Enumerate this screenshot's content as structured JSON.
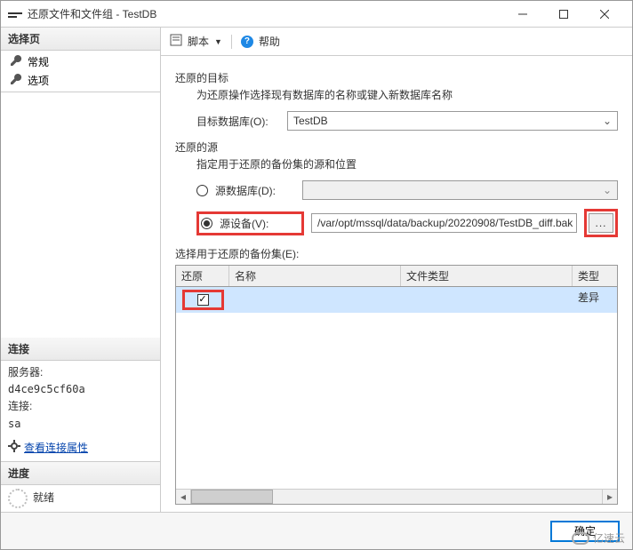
{
  "window": {
    "title": "还原文件和文件组 - TestDB"
  },
  "sidebar": {
    "select_page": "选择页",
    "items": [
      "常规",
      "选项"
    ],
    "connection_header": "连接",
    "server_label": "服务器:",
    "server_value": "d4ce9c5cf60a",
    "conn_label": "连接:",
    "conn_value": "sa",
    "view_props": "查看连接属性",
    "progress_header": "进度",
    "progress_status": "就绪"
  },
  "toolbar": {
    "script_label": "脚本",
    "help_label": "帮助"
  },
  "restore": {
    "target_title": "还原的目标",
    "target_sub": "为还原操作选择现有数据库的名称或键入新数据库名称",
    "target_db_label": "目标数据库(O):",
    "target_db_value": "TestDB",
    "source_title": "还原的源",
    "source_sub": "指定用于还原的备份集的源和位置",
    "radio_db_label": "源数据库(D):",
    "radio_dev_label": "源设备(V):",
    "device_path": "/var/opt/mssql/data/backup/20220908/TestDB_diff.bak",
    "browse": "...",
    "select_sets_label": "选择用于还原的备份集(E):",
    "cols": {
      "restore": "还原",
      "name": "名称",
      "file_type": "文件类型",
      "type": "类型"
    },
    "row0": {
      "type": "差异"
    }
  },
  "footer": {
    "ok": "确定"
  },
  "watermark": "亿速云"
}
